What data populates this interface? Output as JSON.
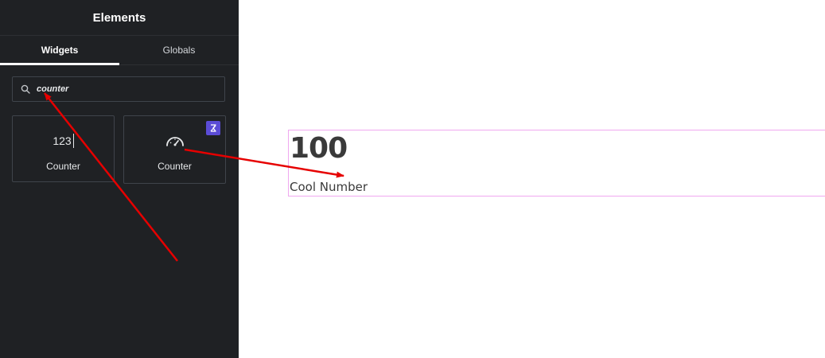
{
  "sidebar": {
    "title": "Elements",
    "tabs": [
      {
        "label": "Widgets",
        "active": true
      },
      {
        "label": "Globals",
        "active": false
      }
    ],
    "search": {
      "value": "counter",
      "icon": "search-icon"
    },
    "widgets": [
      {
        "label": "Counter",
        "icon": "counter-123-icon",
        "icon_text": "123",
        "pro": false
      },
      {
        "label": "Counter",
        "icon": "speedometer-icon",
        "pro": true,
        "badge_icon": "pro-badge-icon"
      }
    ]
  },
  "canvas": {
    "counter": {
      "number": "100",
      "title": "Cool Number"
    }
  },
  "colors": {
    "sidebar_bg": "#1f2124",
    "pro_badge": "#5b4cd6",
    "selection_border": "#f0a8f0",
    "annotation_arrow": "#e60000"
  }
}
